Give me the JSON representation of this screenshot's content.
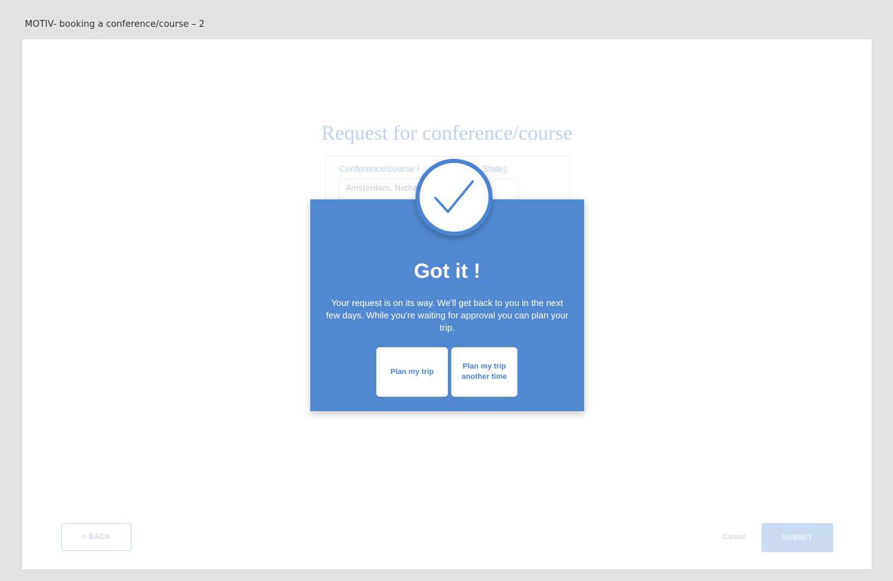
{
  "window": {
    "title": "MOTIV- booking a conference/course – 2"
  },
  "form": {
    "title": "Request for conference/course",
    "field_label": "Conference/course l",
    "field_label_tail": "State):",
    "field_value": "Amsterdam, Nethe"
  },
  "footer": {
    "back_label": "< BACK",
    "cancel_label": "Cancel",
    "submit_label": "SUBMIT"
  },
  "modal": {
    "heading": "Got it !",
    "message": "Your request is on its way. We'll get back to you in the next few days. While you're waiting for approval you can plan your trip.",
    "plan_now_label": "Plan my trip",
    "plan_later_label": "Plan my trip another time",
    "icon": "checkmark-icon"
  },
  "colors": {
    "modal_bg": "#5288d2",
    "accent": "#4a84d3",
    "faded_accent": "#bfd2ee"
  }
}
